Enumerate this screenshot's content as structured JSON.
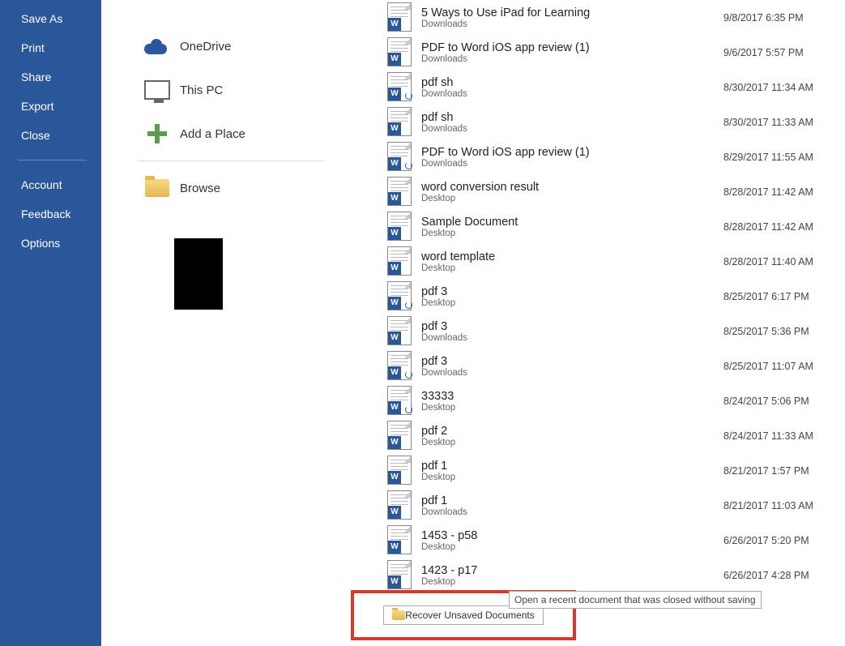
{
  "sidebar": {
    "items": [
      {
        "label": "Save As"
      },
      {
        "label": "Print"
      },
      {
        "label": "Share"
      },
      {
        "label": "Export"
      },
      {
        "label": "Close"
      }
    ],
    "bottom": [
      {
        "label": "Account"
      },
      {
        "label": "Feedback"
      },
      {
        "label": "Options"
      }
    ]
  },
  "locations": [
    {
      "label": "OneDrive",
      "icon": "onedrive"
    },
    {
      "label": "This PC",
      "icon": "thispc"
    },
    {
      "label": "Add a Place",
      "icon": "plus"
    },
    {
      "label": "Browse",
      "icon": "folder"
    }
  ],
  "files": [
    {
      "name": "5 Ways to Use iPad for Learning",
      "loc": "Downloads",
      "date": "9/8/2017 6:35 PM",
      "recovered": false
    },
    {
      "name": "PDF to Word iOS app review (1)",
      "loc": "Downloads",
      "date": "9/6/2017 5:57 PM",
      "recovered": false
    },
    {
      "name": "pdf sh",
      "loc": "Downloads",
      "date": "8/30/2017 11:34 AM",
      "recovered": true
    },
    {
      "name": "pdf sh",
      "loc": "Downloads",
      "date": "8/30/2017 11:33 AM",
      "recovered": false
    },
    {
      "name": "PDF to Word iOS app review (1)",
      "loc": "Downloads",
      "date": "8/29/2017 11:55 AM",
      "recovered": true
    },
    {
      "name": "word conversion result",
      "loc": "Desktop",
      "date": "8/28/2017 11:42 AM",
      "recovered": false
    },
    {
      "name": "Sample Document",
      "loc": "Desktop",
      "date": "8/28/2017 11:42 AM",
      "recovered": false
    },
    {
      "name": "word template",
      "loc": "Desktop",
      "date": "8/28/2017 11:40 AM",
      "recovered": false
    },
    {
      "name": "pdf 3",
      "loc": "Desktop",
      "date": "8/25/2017 6:17 PM",
      "recovered": true
    },
    {
      "name": "pdf 3",
      "loc": "Downloads",
      "date": "8/25/2017 5:36 PM",
      "recovered": false
    },
    {
      "name": "pdf 3",
      "loc": "Downloads",
      "date": "8/25/2017 11:07 AM",
      "recovered": true
    },
    {
      "name": "33333",
      "loc": "Desktop",
      "date": "8/24/2017 5:06 PM",
      "recovered": true
    },
    {
      "name": "pdf 2",
      "loc": "Desktop",
      "date": "8/24/2017 11:33 AM",
      "recovered": false
    },
    {
      "name": "pdf 1",
      "loc": "Desktop",
      "date": "8/21/2017 1:57 PM",
      "recovered": false
    },
    {
      "name": "pdf 1",
      "loc": "Downloads",
      "date": "8/21/2017 11:03 AM",
      "recovered": false
    },
    {
      "name": "1453 - p58",
      "loc": "Desktop",
      "date": "6/26/2017 5:20 PM",
      "recovered": false
    },
    {
      "name": "1423 - p17",
      "loc": "Desktop",
      "date": "6/26/2017 4:28 PM",
      "recovered": false
    }
  ],
  "recover": {
    "button": "Recover Unsaved Documents",
    "tooltip": "Open a recent document that was closed without saving"
  }
}
